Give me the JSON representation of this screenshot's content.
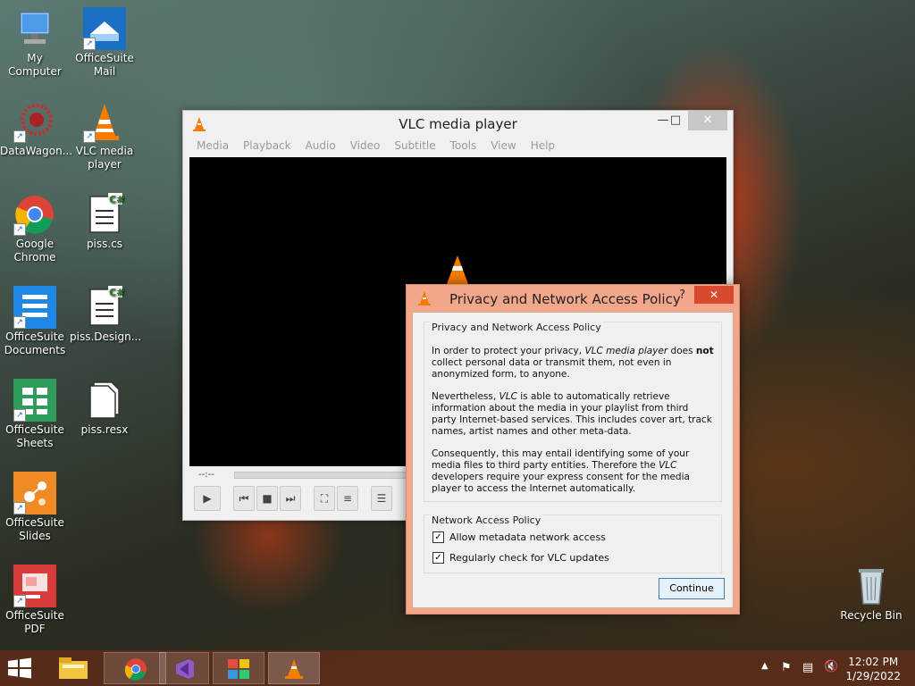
{
  "desktop": {
    "icons": [
      {
        "label": "My Computer"
      },
      {
        "label": "OfficeSuite Mail"
      },
      {
        "label": "DataWagon..."
      },
      {
        "label": "VLC media player"
      },
      {
        "label": "Google Chrome"
      },
      {
        "label": "piss.cs"
      },
      {
        "label": "OfficeSuite Documents"
      },
      {
        "label": "piss.Design..."
      },
      {
        "label": "OfficeSuite Sheets"
      },
      {
        "label": "piss.resx"
      },
      {
        "label": "OfficeSuite Slides"
      },
      {
        "label": "OfficeSuite PDF"
      },
      {
        "label": "Recycle Bin"
      }
    ]
  },
  "vlc": {
    "title": "VLC media player",
    "menu": [
      "Media",
      "Playback",
      "Audio",
      "Video",
      "Subtitle",
      "Tools",
      "View",
      "Help"
    ],
    "time": "--:--"
  },
  "dialog": {
    "title": "Privacy and Network Access Policy",
    "help_glyph": "?",
    "group1_title": "Privacy and Network Access Policy",
    "p1_a": "In order to protect your privacy, ",
    "p1_em": "VLC media player",
    "p1_b": " does ",
    "p1_strong": "not",
    "p1_c": " collect personal data or transmit them, not even in anonymized form, to anyone.",
    "p2_a": "Nevertheless, ",
    "p2_em": "VLC",
    "p2_b": " is able to automatically retrieve information about the media in your playlist from third party Internet-based services. This includes cover art, track names, artist names and other meta-data.",
    "p3_a": "Consequently, this may entail identifying some of your media files to third party entities. Therefore the ",
    "p3_em": "VLC",
    "p3_b": " developers require your express consent for the media player to access the Internet automatically.",
    "group2_title": "Network Access Policy",
    "check1": "Allow metadata network access",
    "check2": "Regularly check for VLC updates",
    "continue_label": "Continue"
  },
  "taskbar": {
    "time": "12:02 PM",
    "date": "1/29/2022"
  }
}
